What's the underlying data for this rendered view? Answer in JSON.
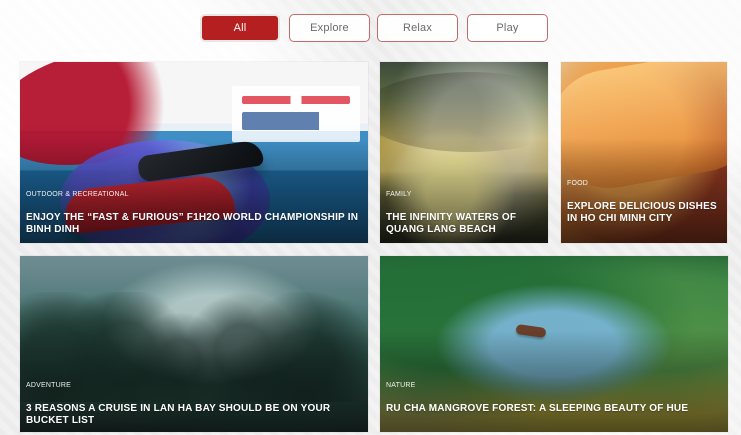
{
  "filters": [
    {
      "label": "All",
      "active": true
    },
    {
      "label": "Explore",
      "active": false
    },
    {
      "label": "Relax",
      "active": false
    },
    {
      "label": "Play",
      "active": false
    }
  ],
  "cards": [
    {
      "category": "OUTDOOR & RECREATIONAL",
      "title": "ENJOY THE “FAST & FURIOUS” F1H2O WORLD CHAMPIONSHIP IN BINH DINH",
      "visual_icon": "jet-ski-poster"
    },
    {
      "category": "FAMILY",
      "title": "THE INFINITY WATERS OF QUANG LANG BEACH",
      "visual_icon": "sunset-sea"
    },
    {
      "category": "FOOD",
      "title": "EXPLORE DELICIOUS DISHES IN HO CHI MINH CITY",
      "visual_icon": "banh-mi"
    },
    {
      "category": "ADVENTURE",
      "title": "3 REASONS A CRUISE IN LAN HA BAY SHOULD BE ON YOUR BUCKET LIST",
      "visual_icon": "bay-islands"
    },
    {
      "category": "NATURE",
      "title": "RU CHA MANGROVE FOREST: A SLEEPING BEAUTY OF HUE",
      "visual_icon": "mangrove-forest"
    }
  ],
  "colors": {
    "accent": "#b51f1f"
  }
}
